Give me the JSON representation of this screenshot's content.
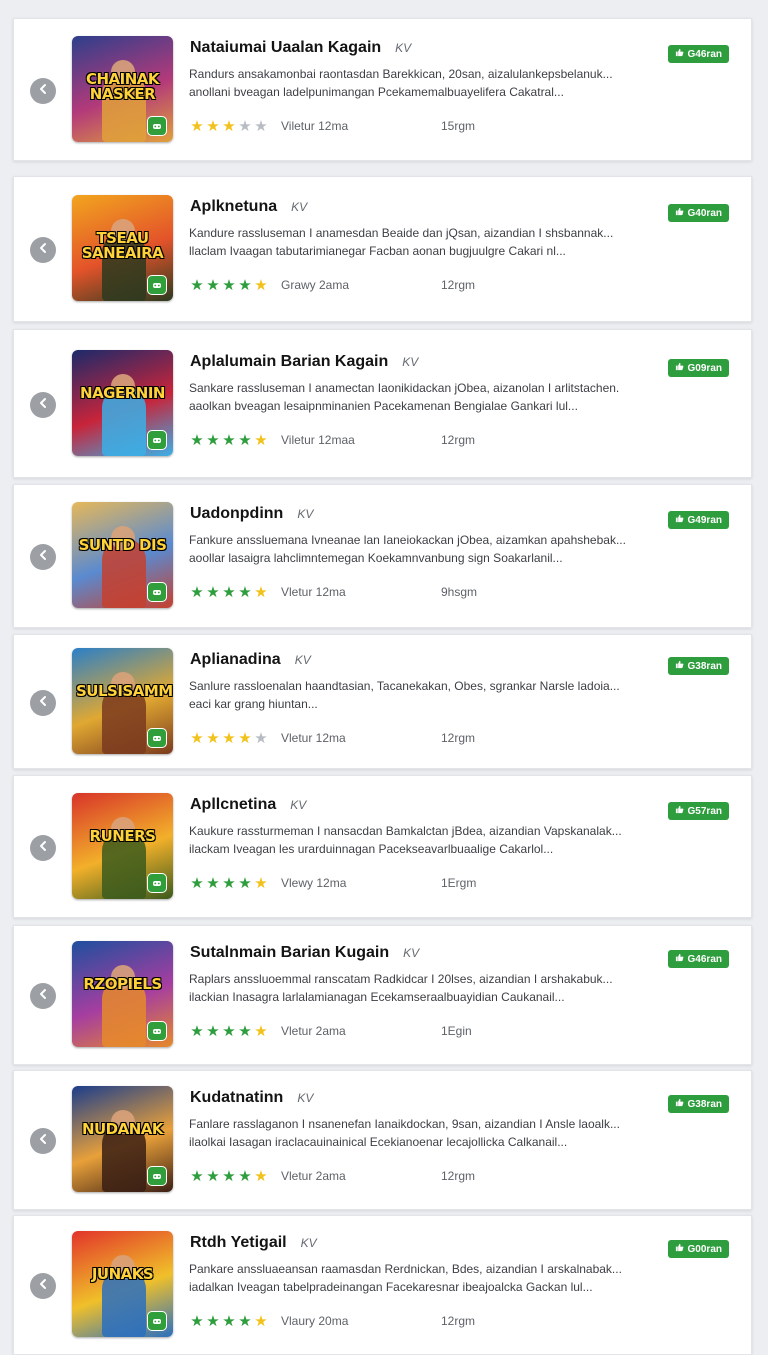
{
  "colors": {
    "accent_green": "#2e9d3d",
    "star_gold": "#f2c21b",
    "star_green": "#2e9d3d",
    "star_grey": "#b7bcc3",
    "back_button": "#9c9fa4"
  },
  "icons": {
    "back": "chevron-left-icon",
    "price": "thumbs-up-icon",
    "thumb_badge": "gamepad-icon"
  },
  "apps": [
    {
      "title": "Nataiumai Uaalan Kagain",
      "tag": "KV",
      "desc_1": "Randurs ansakamonbai raontasdan Barekkican, 20san, aizalulankepsbelanuk...",
      "desc_2": "anollani bveagan ladelpunimangan Pcekamemalbuayelifera Cakatral...",
      "rating": 2.5,
      "rating_label": "Viletur 12ma",
      "meta": "15rgm",
      "price": "G46ran",
      "thumb_text": "CHAINAK NASKER",
      "thumb_colors": [
        "#2d3f8c",
        "#b33a7a",
        "#e1a13a"
      ]
    },
    {
      "title": "Aplknetuna",
      "tag": "KV",
      "desc_1": "Kandure rassluseman I anamesdan Beaide dan jQsan, aizandian I shsbannak...",
      "desc_2": "llaclam Ivaagan tabutarimianegar Facban aonan bugjuulgre Cakari nl...",
      "rating": 5,
      "rating_label": "Grawy 2ama",
      "meta": "12rgm",
      "price": "G40ran",
      "thumb_text": "TSEAU SANEAIRA",
      "thumb_colors": [
        "#f2a51f",
        "#e3532a",
        "#2b3a1f"
      ]
    },
    {
      "title": "Aplalumain Barian Kagain",
      "tag": "KV",
      "desc_1": "Sankare rassluseman I anamectan Iaonikidackan jObea, aizanolan I arlitstachen.",
      "desc_2": "aaolkan bveagan lesaipnminanien Pacekamenan Bengialae Gankari lul...",
      "rating": 5,
      "rating_label": "Viletur 12maa",
      "meta": "12rgm",
      "price": "G09ran",
      "thumb_text": "NAGERNIN",
      "thumb_colors": [
        "#1b2a6b",
        "#c8243a",
        "#3ab0e8"
      ]
    },
    {
      "title": "Uadonpdinn",
      "tag": "KV",
      "desc_1": "Fankure anssluemana Ivneanae lan Ianeiokackan jObea, aizamkan apahshebak...",
      "desc_2": "aoollar lasaigra lahclimntemegan Koekamnvanbung sign Soakarlanil...",
      "rating": 5,
      "rating_label": "Vletur 12ma",
      "meta": "9hsgm",
      "price": "G49ran",
      "thumb_text": "SUNTD DIS",
      "thumb_colors": [
        "#e6b85a",
        "#5a8ad0",
        "#c6402e"
      ]
    },
    {
      "title": "Aplianadina",
      "tag": "KV",
      "desc_1": "Sanlure rassloenalan haandtasian, Tacanekakan, Obes, sgrankar Narsle ladoia...",
      "desc_2": "eaci kar grang hiuntan...",
      "rating": 3.5,
      "rating_label": "Vletur 12ma",
      "meta": "12rgm",
      "price": "G38ran",
      "thumb_text": "SULSISAMM",
      "thumb_colors": [
        "#2a7fc8",
        "#e0a832",
        "#7a3a1e"
      ]
    },
    {
      "title": "Apllcnetina",
      "tag": "KV",
      "desc_1": "Kaukure rassturmeman I nansacdan Bamkalctan jBdea, aizandian Vapskanalak...",
      "desc_2": "ilackam Iveagan les urarduinnagan Pacekseavarlbuaalige Cakarlol...",
      "rating": 5,
      "rating_label": "Vlewy 12ma",
      "meta": "1Ergm",
      "price": "G57ran",
      "thumb_text": "RUNERS",
      "thumb_colors": [
        "#d8342a",
        "#f2b02a",
        "#3b5a1c"
      ]
    },
    {
      "title": "Sutalnmain Barian Kugain",
      "tag": "KV",
      "desc_1": "Raplars anssluoemmal ranscatam Radkidcar I 20lses, aizandian I arshakabuk...",
      "desc_2": "ilackian Inasagra larlalamianagan Ecekamseraalbuayidian Caukanail...",
      "rating": 5,
      "rating_label": "Vletur 2ama",
      "meta": "1Egin",
      "price": "G46ran",
      "thumb_text": "RZOPIELS",
      "thumb_colors": [
        "#1e4f9e",
        "#a63ea0",
        "#e68a2a"
      ]
    },
    {
      "title": "Kudatnatinn",
      "tag": "KV",
      "desc_1": "Fanlare rasslaganon I nsanenefan Ianaikdockan, 9san, aizandian I Ansle laoalk...",
      "desc_2": "ilaolkai Iasagan iraclacauinainical Ecekianoenar lecajollicka Calkanail...",
      "rating": 5,
      "rating_label": "Vletur 2ama",
      "meta": "12rgm",
      "price": "G38ran",
      "thumb_text": "NUDANAK",
      "thumb_colors": [
        "#1b3d8c",
        "#e8a03a",
        "#3a1e14"
      ]
    },
    {
      "title": "Rtdh Yetigail",
      "tag": "KV",
      "desc_1": "Pankare anssluaeansan raamasdan Rerdnickan, Bdes, aizandian I arskalnabak...",
      "desc_2": "iadalkan Iveagan tabelpradeinangan Facekaresnar ibeajoalcka Gackan lul...",
      "rating": 5,
      "rating_label": "Vlaury 20ma",
      "meta": "12rgm",
      "price": "G00ran",
      "thumb_text": "JUNAKS",
      "thumb_colors": [
        "#e2342a",
        "#f0c02a",
        "#2a6fc0"
      ]
    }
  ]
}
